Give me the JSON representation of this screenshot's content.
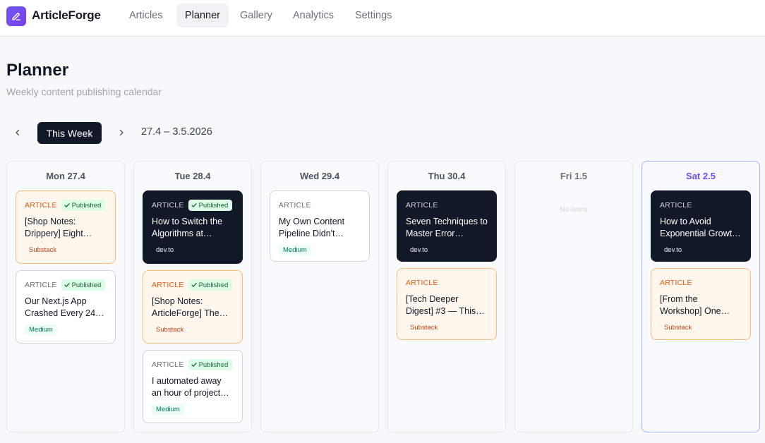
{
  "app": {
    "name": "ArticleForge"
  },
  "nav": [
    {
      "label": "Articles"
    },
    {
      "label": "Planner"
    },
    {
      "label": "Gallery"
    },
    {
      "label": "Analytics"
    },
    {
      "label": "Settings"
    }
  ],
  "nav_active": "Planner",
  "page": {
    "title": "Planner",
    "subtitle": "Weekly content publishing calendar"
  },
  "week": {
    "this_week_label": "This Week",
    "range": "27.4 – 3.5.2026"
  },
  "columns": [
    {
      "day": "Mon 27.4",
      "items": [
        {
          "label": "ARTICLE",
          "status": "Published",
          "title": "[Shop Notes: Drippery] Eight…",
          "platform": "Substack"
        },
        {
          "label": "ARTICLE",
          "status": "Published",
          "title": "Our Next.js App Crashed Every 24…",
          "platform": "Medium"
        }
      ]
    },
    {
      "day": "Tue 28.4",
      "items": [
        {
          "label": "ARTICLE",
          "status": "Published",
          "title": "How to Switch the Algorithms at…",
          "platform": "dev.to"
        },
        {
          "label": "ARTICLE",
          "status": "Published",
          "title": "[Shop Notes: ArticleForge] The…",
          "platform": "Substack"
        },
        {
          "label": "ARTICLE",
          "status": "Published",
          "title": "I automated away an hour of project…",
          "platform": "Medium"
        }
      ]
    },
    {
      "day": "Wed 29.4",
      "items": [
        {
          "label": "ARTICLE",
          "status": "",
          "title": "My Own Content Pipeline Didn't Hav…",
          "platform": "Medium"
        }
      ]
    },
    {
      "day": "Thu 30.4",
      "items": [
        {
          "label": "ARTICLE",
          "status": "",
          "title": "Seven Techniques to Master Error…",
          "platform": "dev.to"
        },
        {
          "label": "ARTICLE",
          "status": "",
          "title": "[Tech Deeper Digest] #3 — This…",
          "platform": "Substack"
        }
      ]
    },
    {
      "day": "Fri 1.5",
      "empty_text": "No items",
      "items": []
    },
    {
      "day": "Sat 2.5",
      "items": [
        {
          "label": "ARTICLE",
          "status": "",
          "title": "How to Avoid Exponential Growt…",
          "platform": "dev.to"
        },
        {
          "label": "ARTICLE",
          "status": "",
          "title": "[From the Workshop] One…",
          "platform": "Substack"
        }
      ]
    }
  ],
  "colors": {
    "accent": "#7c3aed",
    "dark_card": "#111827",
    "substack_bg": "#fff7ed",
    "substack_border": "#fdba74",
    "published_bg": "#dcfce7",
    "today_border": "#a5b4fc"
  },
  "icons": {
    "logo": "pencil-icon",
    "prev": "chevron-left-icon",
    "next": "chevron-right-icon",
    "published": "check-icon"
  }
}
